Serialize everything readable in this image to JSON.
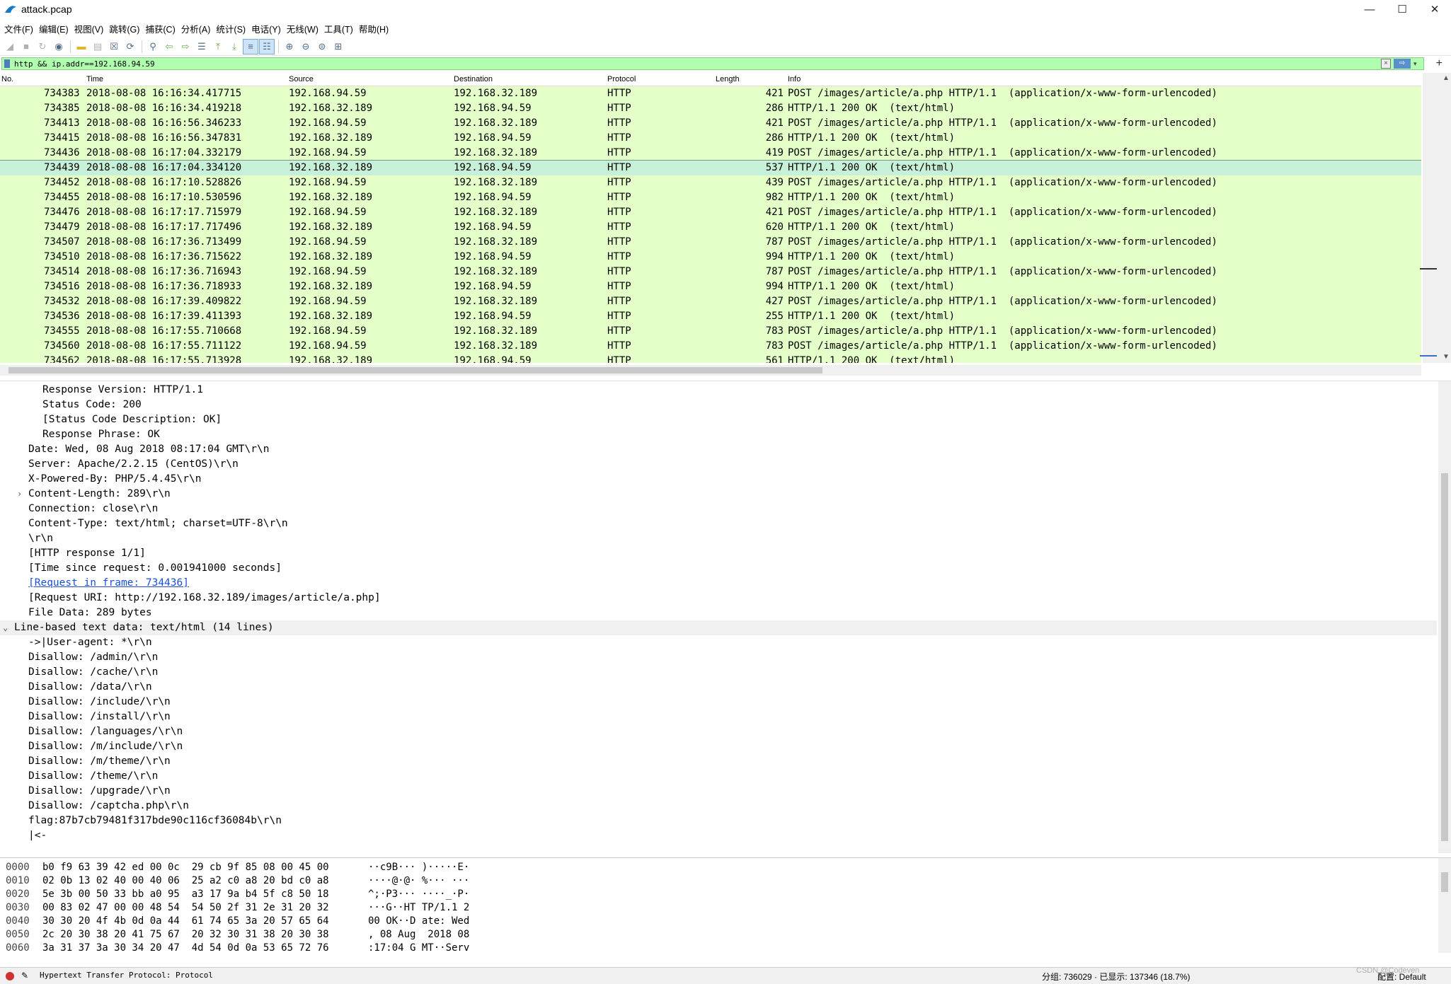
{
  "window": {
    "title": "attack.pcap",
    "minimize": "—",
    "maximize": "☐",
    "close": "✕"
  },
  "menu": [
    "文件(F)",
    "编辑(E)",
    "视图(V)",
    "跳转(G)",
    "捕获(C)",
    "分析(A)",
    "统计(S)",
    "电话(Y)",
    "无线(W)",
    "工具(T)",
    "帮助(H)"
  ],
  "toolbar": {
    "icons": [
      "shark-fin-start-icon",
      "stop-icon",
      "restart-icon",
      "options-gear-icon",
      "open-folder-icon",
      "save-icon",
      "close-file-icon",
      "reload-icon",
      "find-icon",
      "go-back-icon",
      "go-forward-icon",
      "go-to-packet-icon",
      "first-packet-icon",
      "last-packet-icon",
      "autoscroll-icon",
      "colorize-icon",
      "zoom-in-icon",
      "zoom-out-icon",
      "normal-size-icon",
      "resize-columns-icon"
    ]
  },
  "filter": {
    "value": "http && ip.addr==192.168.94.59",
    "add": "+"
  },
  "packet_list": {
    "columns": [
      "No.",
      "Time",
      "Source",
      "Destination",
      "Protocol",
      "Length",
      "Info"
    ],
    "rows": [
      {
        "no": "734383",
        "time": "2018-08-08 16:16:34.417715",
        "src": "192.168.94.59",
        "dst": "192.168.32.189",
        "proto": "HTTP",
        "len": "421",
        "info": "POST /images/article/a.php HTTP/1.1  (application/x-www-form-urlencoded)"
      },
      {
        "no": "734385",
        "time": "2018-08-08 16:16:34.419218",
        "src": "192.168.32.189",
        "dst": "192.168.94.59",
        "proto": "HTTP",
        "len": "286",
        "info": "HTTP/1.1 200 OK  (text/html)"
      },
      {
        "no": "734413",
        "time": "2018-08-08 16:16:56.346233",
        "src": "192.168.94.59",
        "dst": "192.168.32.189",
        "proto": "HTTP",
        "len": "421",
        "info": "POST /images/article/a.php HTTP/1.1  (application/x-www-form-urlencoded)"
      },
      {
        "no": "734415",
        "time": "2018-08-08 16:16:56.347831",
        "src": "192.168.32.189",
        "dst": "192.168.94.59",
        "proto": "HTTP",
        "len": "286",
        "info": "HTTP/1.1 200 OK  (text/html)"
      },
      {
        "no": "734436",
        "time": "2018-08-08 16:17:04.332179",
        "src": "192.168.94.59",
        "dst": "192.168.32.189",
        "proto": "HTTP",
        "len": "419",
        "info": "POST /images/article/a.php HTTP/1.1  (application/x-www-form-urlencoded)"
      },
      {
        "no": "734439",
        "time": "2018-08-08 16:17:04.334120",
        "src": "192.168.32.189",
        "dst": "192.168.94.59",
        "proto": "HTTP",
        "len": "537",
        "info": "HTTP/1.1 200 OK  (text/html)"
      },
      {
        "no": "734452",
        "time": "2018-08-08 16:17:10.528826",
        "src": "192.168.94.59",
        "dst": "192.168.32.189",
        "proto": "HTTP",
        "len": "439",
        "info": "POST /images/article/a.php HTTP/1.1  (application/x-www-form-urlencoded)"
      },
      {
        "no": "734455",
        "time": "2018-08-08 16:17:10.530596",
        "src": "192.168.32.189",
        "dst": "192.168.94.59",
        "proto": "HTTP",
        "len": "982",
        "info": "HTTP/1.1 200 OK  (text/html)"
      },
      {
        "no": "734476",
        "time": "2018-08-08 16:17:17.715979",
        "src": "192.168.94.59",
        "dst": "192.168.32.189",
        "proto": "HTTP",
        "len": "421",
        "info": "POST /images/article/a.php HTTP/1.1  (application/x-www-form-urlencoded)"
      },
      {
        "no": "734479",
        "time": "2018-08-08 16:17:17.717496",
        "src": "192.168.32.189",
        "dst": "192.168.94.59",
        "proto": "HTTP",
        "len": "620",
        "info": "HTTP/1.1 200 OK  (text/html)"
      },
      {
        "no": "734507",
        "time": "2018-08-08 16:17:36.713499",
        "src": "192.168.94.59",
        "dst": "192.168.32.189",
        "proto": "HTTP",
        "len": "787",
        "info": "POST /images/article/a.php HTTP/1.1  (application/x-www-form-urlencoded)"
      },
      {
        "no": "734510",
        "time": "2018-08-08 16:17:36.715622",
        "src": "192.168.32.189",
        "dst": "192.168.94.59",
        "proto": "HTTP",
        "len": "994",
        "info": "HTTP/1.1 200 OK  (text/html)"
      },
      {
        "no": "734514",
        "time": "2018-08-08 16:17:36.716943",
        "src": "192.168.94.59",
        "dst": "192.168.32.189",
        "proto": "HTTP",
        "len": "787",
        "info": "POST /images/article/a.php HTTP/1.1  (application/x-www-form-urlencoded)"
      },
      {
        "no": "734516",
        "time": "2018-08-08 16:17:36.718933",
        "src": "192.168.32.189",
        "dst": "192.168.94.59",
        "proto": "HTTP",
        "len": "994",
        "info": "HTTP/1.1 200 OK  (text/html)"
      },
      {
        "no": "734532",
        "time": "2018-08-08 16:17:39.409822",
        "src": "192.168.94.59",
        "dst": "192.168.32.189",
        "proto": "HTTP",
        "len": "427",
        "info": "POST /images/article/a.php HTTP/1.1  (application/x-www-form-urlencoded)"
      },
      {
        "no": "734536",
        "time": "2018-08-08 16:17:39.411393",
        "src": "192.168.32.189",
        "dst": "192.168.94.59",
        "proto": "HTTP",
        "len": "255",
        "info": "HTTP/1.1 200 OK  (text/html)"
      },
      {
        "no": "734555",
        "time": "2018-08-08 16:17:55.710668",
        "src": "192.168.94.59",
        "dst": "192.168.32.189",
        "proto": "HTTP",
        "len": "783",
        "info": "POST /images/article/a.php HTTP/1.1  (application/x-www-form-urlencoded)"
      },
      {
        "no": "734560",
        "time": "2018-08-08 16:17:55.711122",
        "src": "192.168.94.59",
        "dst": "192.168.32.189",
        "proto": "HTTP",
        "len": "783",
        "info": "POST /images/article/a.php HTTP/1.1  (application/x-www-form-urlencoded)"
      },
      {
        "no": "734562",
        "time": "2018-08-08 16:17:55.713928",
        "src": "192.168.32.189",
        "dst": "192.168.94.59",
        "proto": "HTTP",
        "len": "561",
        "info": "HTTP/1.1 200 OK  (text/html)"
      }
    ],
    "selected_index": 5,
    "row_color": "#e4ffc7",
    "selected_color": "#c7f0d8"
  },
  "details": {
    "lines": [
      {
        "indent": 3,
        "text": "Response Version: HTTP/1.1"
      },
      {
        "indent": 3,
        "text": "Status Code: 200"
      },
      {
        "indent": 3,
        "text": "[Status Code Description: OK]"
      },
      {
        "indent": 3,
        "text": "Response Phrase: OK"
      },
      {
        "indent": 2,
        "text": "Date: Wed, 08 Aug 2018 08:17:04 GMT\\r\\n"
      },
      {
        "indent": 2,
        "text": "Server: Apache/2.2.15 (CentOS)\\r\\n"
      },
      {
        "indent": 2,
        "text": "X-Powered-By: PHP/5.4.45\\r\\n"
      },
      {
        "indent": 2,
        "text": "Content-Length: 289\\r\\n",
        "expander": "›"
      },
      {
        "indent": 2,
        "text": "Connection: close\\r\\n"
      },
      {
        "indent": 2,
        "text": "Content-Type: text/html; charset=UTF-8\\r\\n"
      },
      {
        "indent": 2,
        "text": "\\r\\n"
      },
      {
        "indent": 2,
        "text": "[HTTP response 1/1]"
      },
      {
        "indent": 2,
        "text": "[Time since request: 0.001941000 seconds]"
      },
      {
        "indent": 2,
        "text": "[Request in frame: 734436]",
        "link": true
      },
      {
        "indent": 2,
        "text": "[Request URI: http://192.168.32.189/images/article/a.php]"
      },
      {
        "indent": 2,
        "text": "File Data: 289 bytes"
      },
      {
        "indent": 1,
        "text": "Line-based text data: text/html (14 lines)",
        "section": true,
        "expander": "⌄"
      },
      {
        "indent": 2,
        "text": "->|User-agent: *\\r\\n"
      },
      {
        "indent": 2,
        "text": "Disallow: /admin/\\r\\n"
      },
      {
        "indent": 2,
        "text": "Disallow: /cache/\\r\\n"
      },
      {
        "indent": 2,
        "text": "Disallow: /data/\\r\\n"
      },
      {
        "indent": 2,
        "text": "Disallow: /include/\\r\\n"
      },
      {
        "indent": 2,
        "text": "Disallow: /install/\\r\\n"
      },
      {
        "indent": 2,
        "text": "Disallow: /languages/\\r\\n"
      },
      {
        "indent": 2,
        "text": "Disallow: /m/include/\\r\\n"
      },
      {
        "indent": 2,
        "text": "Disallow: /m/theme/\\r\\n"
      },
      {
        "indent": 2,
        "text": "Disallow: /theme/\\r\\n"
      },
      {
        "indent": 2,
        "text": "Disallow: /upgrade/\\r\\n"
      },
      {
        "indent": 2,
        "text": "Disallow: /captcha.php\\r\\n"
      },
      {
        "indent": 2,
        "text": "flag:87b7cb79481f317bde90c116cf36084b\\r\\n"
      },
      {
        "indent": 2,
        "text": "|<-"
      }
    ]
  },
  "bytes": {
    "lines": [
      {
        "offset": "0000",
        "hex": "b0 f9 63 39 42 ed 00 0c  29 cb 9f 85 08 00 45 00",
        "ascii": "··c9B··· )·····E·"
      },
      {
        "offset": "0010",
        "hex": "02 0b 13 02 40 00 40 06  25 a2 c0 a8 20 bd c0 a8",
        "ascii": "····@·@· %··· ···"
      },
      {
        "offset": "0020",
        "hex": "5e 3b 00 50 33 bb a0 95  a3 17 9a b4 5f c8 50 18",
        "ascii": "^;·P3··· ····_·P·"
      },
      {
        "offset": "0030",
        "hex": "00 83 02 47 00 00 48 54  54 50 2f 31 2e 31 20 32",
        "ascii": "···G··HT TP/1.1 2"
      },
      {
        "offset": "0040",
        "hex": "30 30 20 4f 4b 0d 0a 44  61 74 65 3a 20 57 65 64",
        "ascii": "00 OK··D ate: Wed"
      },
      {
        "offset": "0050",
        "hex": "2c 20 30 38 20 41 75 67  20 32 30 31 38 20 30 38",
        "ascii": ", 08 Aug  2018 08"
      },
      {
        "offset": "0060",
        "hex": "3a 31 37 3a 30 34 20 47  4d 54 0d 0a 53 65 72 76",
        "ascii": ":17:04 G MT··Serv"
      }
    ]
  },
  "status": {
    "field": "Hypertext Transfer Protocol: Protocol",
    "counts": "分组: 736029 · 已显示: 137346 (18.7%)",
    "profile": "配置: Default",
    "watermark": "CSDN @Codeven"
  }
}
